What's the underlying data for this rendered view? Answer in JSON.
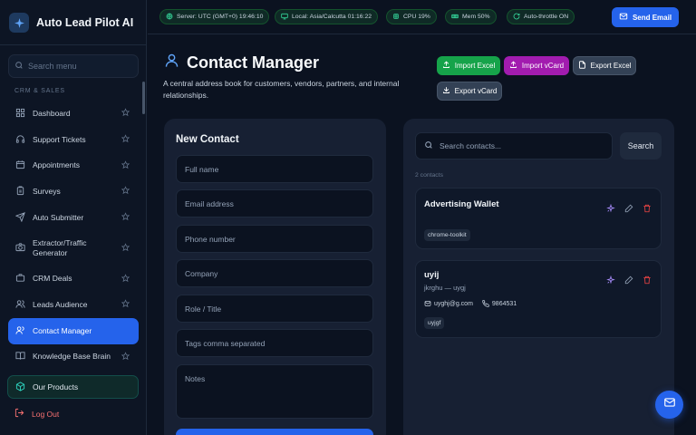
{
  "app": {
    "title": "Auto Lead Pilot AI"
  },
  "sidebar": {
    "search_placeholder": "Search menu",
    "section_label": "CRM & SALES",
    "items": [
      {
        "label": "Dashboard",
        "icon": "grid-icon"
      },
      {
        "label": "Support Tickets",
        "icon": "headset-icon"
      },
      {
        "label": "Appointments",
        "icon": "calendar-icon"
      },
      {
        "label": "Surveys",
        "icon": "clipboard-icon"
      },
      {
        "label": "Auto Submitter",
        "icon": "send-icon"
      },
      {
        "label": "Extractor/Traffic Generator",
        "icon": "camera-icon"
      },
      {
        "label": "CRM Deals",
        "icon": "briefcase-icon"
      },
      {
        "label": "Leads Audience",
        "icon": "users-icon"
      },
      {
        "label": "Contact Manager",
        "icon": "user-icon",
        "active": true
      },
      {
        "label": "Knowledge Base Brain",
        "icon": "book-icon"
      }
    ],
    "products_label": "Our Products",
    "logout_label": "Log Out"
  },
  "topbar": {
    "server": "Server: UTC (GMT+0) 19:46:10",
    "local": "Local: Asia/Calcutta 01:16:22",
    "cpu": "CPU 19%",
    "mem": "Mem 50%",
    "throttle": "Auto-throttle ON",
    "send_email": "Send Email"
  },
  "page": {
    "title": "Contact Manager",
    "description": "A central address book for customers, vendors, partners, and internal relationships.",
    "actions": {
      "import_excel": "Import Excel",
      "import_vcard": "Import vCard",
      "export_excel": "Export Excel",
      "export_vcard": "Export vCard"
    }
  },
  "new_contact": {
    "title": "New Contact",
    "fields": {
      "full_name": "Full name",
      "email": "Email address",
      "phone": "Phone number",
      "company": "Company",
      "role": "Role / Title",
      "tags": "Tags comma separated",
      "notes": "Notes"
    }
  },
  "contacts": {
    "search_placeholder": "Search contacts...",
    "search_button": "Search",
    "count": "2 contacts",
    "items": [
      {
        "name": "Advertising Wallet",
        "tag": "chrome-toolkit"
      },
      {
        "name": "uyij",
        "subtitle": "jkrghu — uygj",
        "email": "uyghj@g.com",
        "phone": "9864531",
        "tag": "uyjgf"
      }
    ]
  },
  "colors": {
    "accent": "#2563eb",
    "green": "#16a34a",
    "purple": "#a21caf",
    "danger": "#ef4444"
  }
}
